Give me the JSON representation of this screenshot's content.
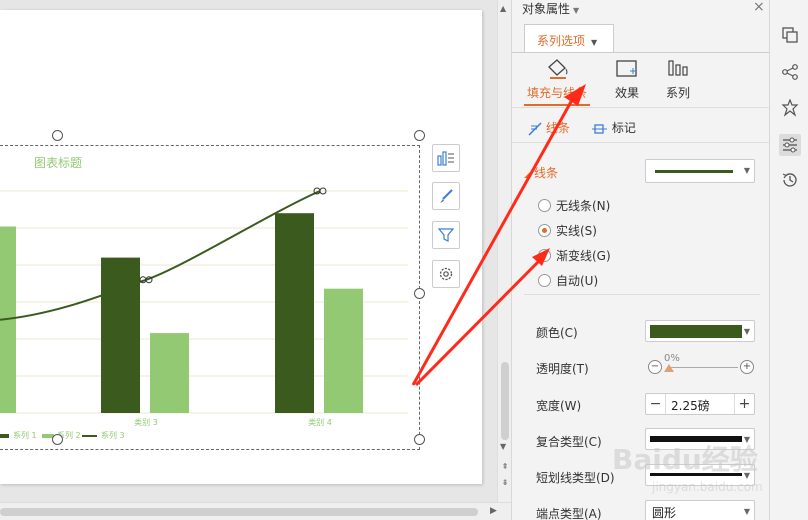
{
  "chart": {
    "title": "图表标题",
    "categories": [
      "类别 3",
      "类别 4"
    ],
    "legend": [
      "系列 1",
      "系列 2",
      "系列 3"
    ]
  },
  "chart_data": {
    "type": "bar",
    "categories": [
      "类别 3",
      "类别 4"
    ],
    "series": [
      {
        "name": "系列 1",
        "values": [
          3.5,
          4.5
        ],
        "color": "#3a5a1e"
      },
      {
        "name": "系列 2",
        "values": [
          1.8,
          2.8
        ],
        "color": "#93c973"
      },
      {
        "name": "系列 3",
        "type": "line",
        "values": [
          3.0,
          5.0
        ],
        "color": "#3a5a1e"
      }
    ],
    "ylim": [
      0,
      5
    ]
  },
  "panel": {
    "title": "对象属性",
    "series_tab": "系列选项",
    "tabs": [
      {
        "label": "填充与线条",
        "icon": "paint-bucket-icon"
      },
      {
        "label": "效果",
        "icon": "effects-icon"
      },
      {
        "label": "系列",
        "icon": "series-bars-icon"
      }
    ],
    "subtabs": [
      {
        "label": "线条",
        "icon": "line-icon"
      },
      {
        "label": "标记",
        "icon": "marker-icon"
      }
    ],
    "line_section": "线条",
    "radios": [
      {
        "label": "无线条(N)",
        "checked": false
      },
      {
        "label": "实线(S)",
        "checked": true
      },
      {
        "label": "渐变线(G)",
        "checked": false
      },
      {
        "label": "自动(U)",
        "checked": false
      }
    ],
    "props": {
      "color": "颜色(C)",
      "transparency": "透明度(T)",
      "transparency_value": "0%",
      "width": "宽度(W)",
      "width_value": "2.25磅",
      "compound": "复合类型(C)",
      "dash": "短划线类型(D)",
      "endpoint": "端点类型(A)",
      "endpoint_value": "圆形"
    },
    "accent_color": "#e06c2b",
    "line_color": "#3a5a1e"
  },
  "watermark": {
    "logo": "Baidu经验",
    "sub": "jingyan.baidu.com"
  }
}
